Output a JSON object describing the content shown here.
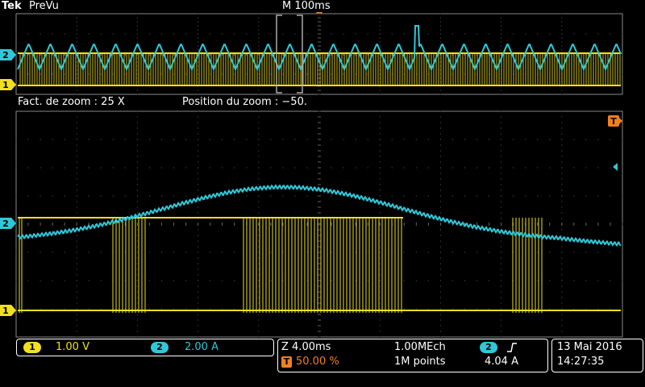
{
  "header": {
    "brand": "Tek",
    "mode": "PreVu",
    "timebase": "M 100ms",
    "trigger_marker": "T"
  },
  "zoom_bar": {
    "zoom_factor_text": "Fact. de zoom : 25 X",
    "zoom_position_text": "Position du zoom  : −50."
  },
  "channels": {
    "ch1": {
      "label": "1",
      "scale": "1.00 V",
      "color": "#f0e020"
    },
    "ch2": {
      "label": "2",
      "scale": "2.00 A",
      "color": "#30c8d8"
    }
  },
  "status": {
    "zoom_time": "Z 4.00ms",
    "trigger_label": "T",
    "trigger_pos": "50.00 %",
    "sample_rate": "1.00MEch",
    "record_length": "1M points",
    "trigger_source": "2",
    "trigger_slope_icon": "rising-edge-icon",
    "trigger_level": "4.04 A",
    "date": "13 Mai  2016",
    "time": "14:27:35"
  },
  "colors": {
    "ch1": "#f0e020",
    "ch2": "#30c8d8",
    "trigger": "#f08020",
    "grid": "#606060"
  }
}
